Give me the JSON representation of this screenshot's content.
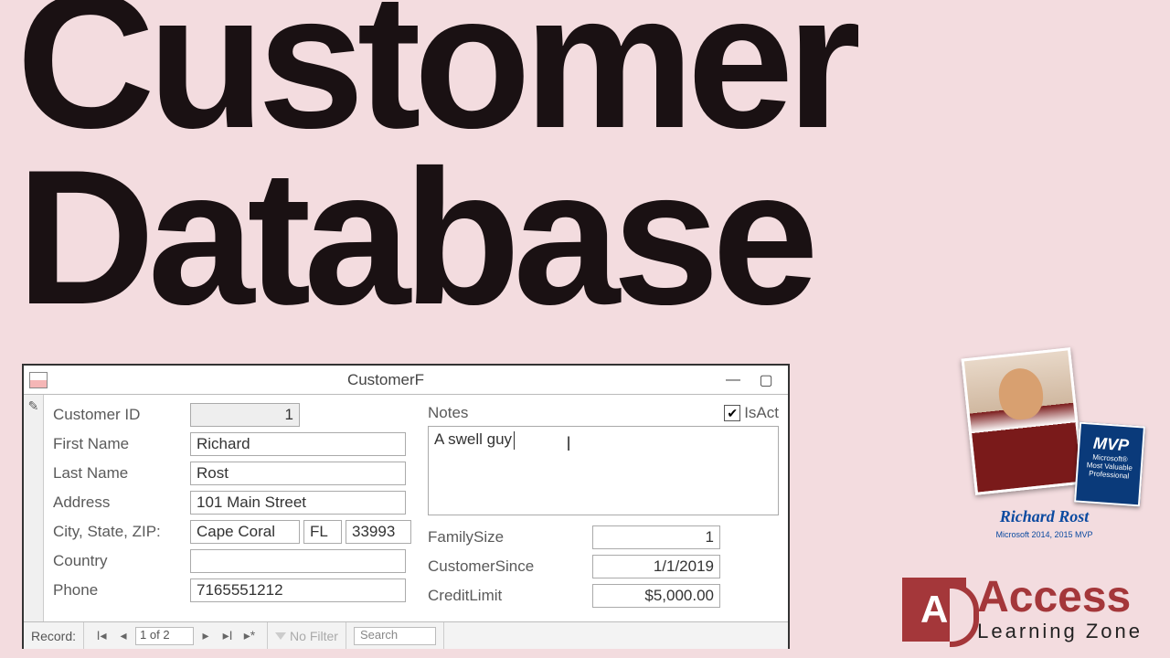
{
  "headline": {
    "line1": "Customer",
    "line2": "Database"
  },
  "window": {
    "title": "CustomerF",
    "min": "—",
    "restore": "▢",
    "selector_icon": "✎"
  },
  "form": {
    "left": {
      "customer_id": {
        "label": "Customer ID",
        "value": "1"
      },
      "first_name": {
        "label": "First Name",
        "value": "Richard"
      },
      "last_name": {
        "label": "Last Name",
        "value": "Rost"
      },
      "address": {
        "label": "Address",
        "value": "101 Main Street"
      },
      "csz": {
        "label": "City, State, ZIP:",
        "city": "Cape Coral",
        "state": "FL",
        "zip": "33993"
      },
      "country": {
        "label": "Country",
        "value": ""
      },
      "phone": {
        "label": "Phone",
        "value": "7165551212"
      }
    },
    "right": {
      "notes": {
        "label": "Notes",
        "value": "A swell guy"
      },
      "is_active": {
        "label": "IsAct",
        "checked": "✔"
      },
      "family_size": {
        "label": "FamilySize",
        "value": "1"
      },
      "customer_since": {
        "label": "CustomerSince",
        "value": "1/1/2019"
      },
      "credit_limit": {
        "label": "CreditLimit",
        "value": "$5,000.00"
      }
    }
  },
  "nav": {
    "label": "Record:",
    "first": "I◂",
    "prev": "◂",
    "pos": "1 of 2",
    "next": "▸",
    "last": "▸I",
    "new": "▸*",
    "no_filter": "No Filter",
    "search_placeholder": "Search"
  },
  "author": {
    "name": "Richard Rost",
    "sub": "Microsoft 2014, 2015 MVP",
    "mvp1": "MVP",
    "mvp2": "Microsoft®",
    "mvp3": "Most Valuable",
    "mvp4": "Professional"
  },
  "brand": {
    "letter": "A",
    "line1": "Access",
    "line2": "Learning Zone"
  }
}
